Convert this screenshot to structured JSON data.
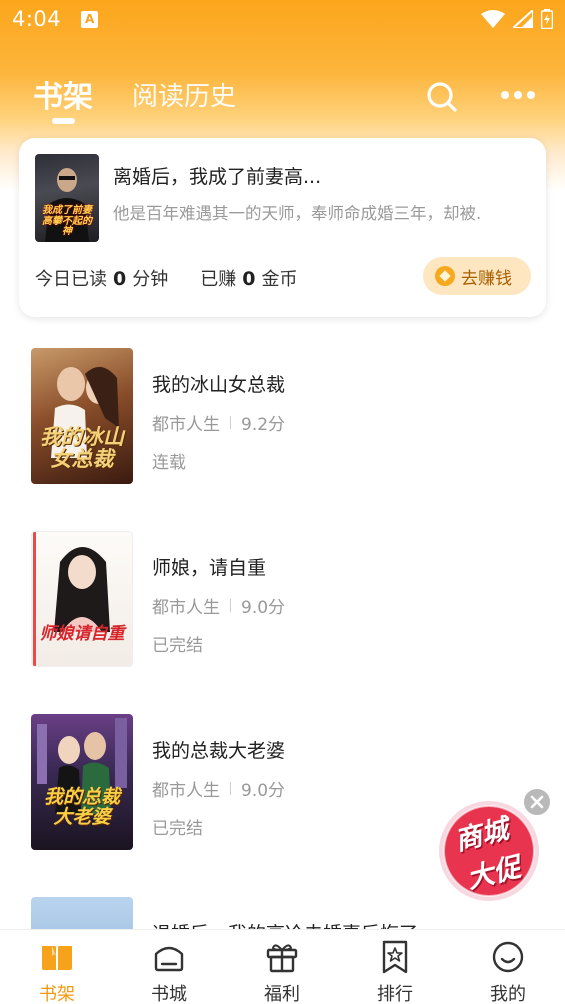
{
  "status_bar": {
    "time": "4:04",
    "notification_icon": "A"
  },
  "header": {
    "tabs": [
      {
        "label": "书架",
        "active": true
      },
      {
        "label": "阅读历史",
        "active": false
      }
    ],
    "search_icon": "search-icon",
    "more_icon": "more-icon"
  },
  "current_reading": {
    "title": "离婚后，我成了前妻高...",
    "description": "他是百年难遇其一的天师，奉师命成婚三年，却被.",
    "cover_text": "我成了前妻高攀不起的神",
    "stats": {
      "read_prefix": "今日已读",
      "read_value": "0",
      "read_unit": "分钟",
      "earn_prefix": "已赚",
      "earn_value": "0",
      "earn_unit": "金币"
    },
    "earn_button": "去赚钱"
  },
  "books": [
    {
      "title": "我的冰山女总裁",
      "category": "都市人生",
      "score": "9.2分",
      "status": "连载",
      "cover_text": "我的冰山女总裁"
    },
    {
      "title": "师娘，请自重",
      "category": "都市人生",
      "score": "9.0分",
      "status": "已完结",
      "cover_text": "师娘请自重"
    },
    {
      "title": "我的总裁大老婆",
      "category": "都市人生",
      "score": "9.0分",
      "status": "已完结",
      "cover_text": "我的总裁大老婆"
    },
    {
      "title": "退婚后，我的高冷未婚妻后悔了",
      "category": "",
      "score": "",
      "status": ""
    }
  ],
  "promo": {
    "line1": "商城",
    "line2": "大促"
  },
  "bottom_nav": [
    {
      "label": "书架",
      "icon": "bookshelf-icon",
      "active": true
    },
    {
      "label": "书城",
      "icon": "bookstore-icon",
      "active": false
    },
    {
      "label": "福利",
      "icon": "gift-icon",
      "active": false
    },
    {
      "label": "排行",
      "icon": "ranking-icon",
      "active": false
    },
    {
      "label": "我的",
      "icon": "profile-icon",
      "active": false
    }
  ],
  "colors": {
    "accent": "#f39a12",
    "header_orange": "#fca61c",
    "earn_button_bg": "#fde6c0",
    "promo_red": "#e8344e"
  }
}
